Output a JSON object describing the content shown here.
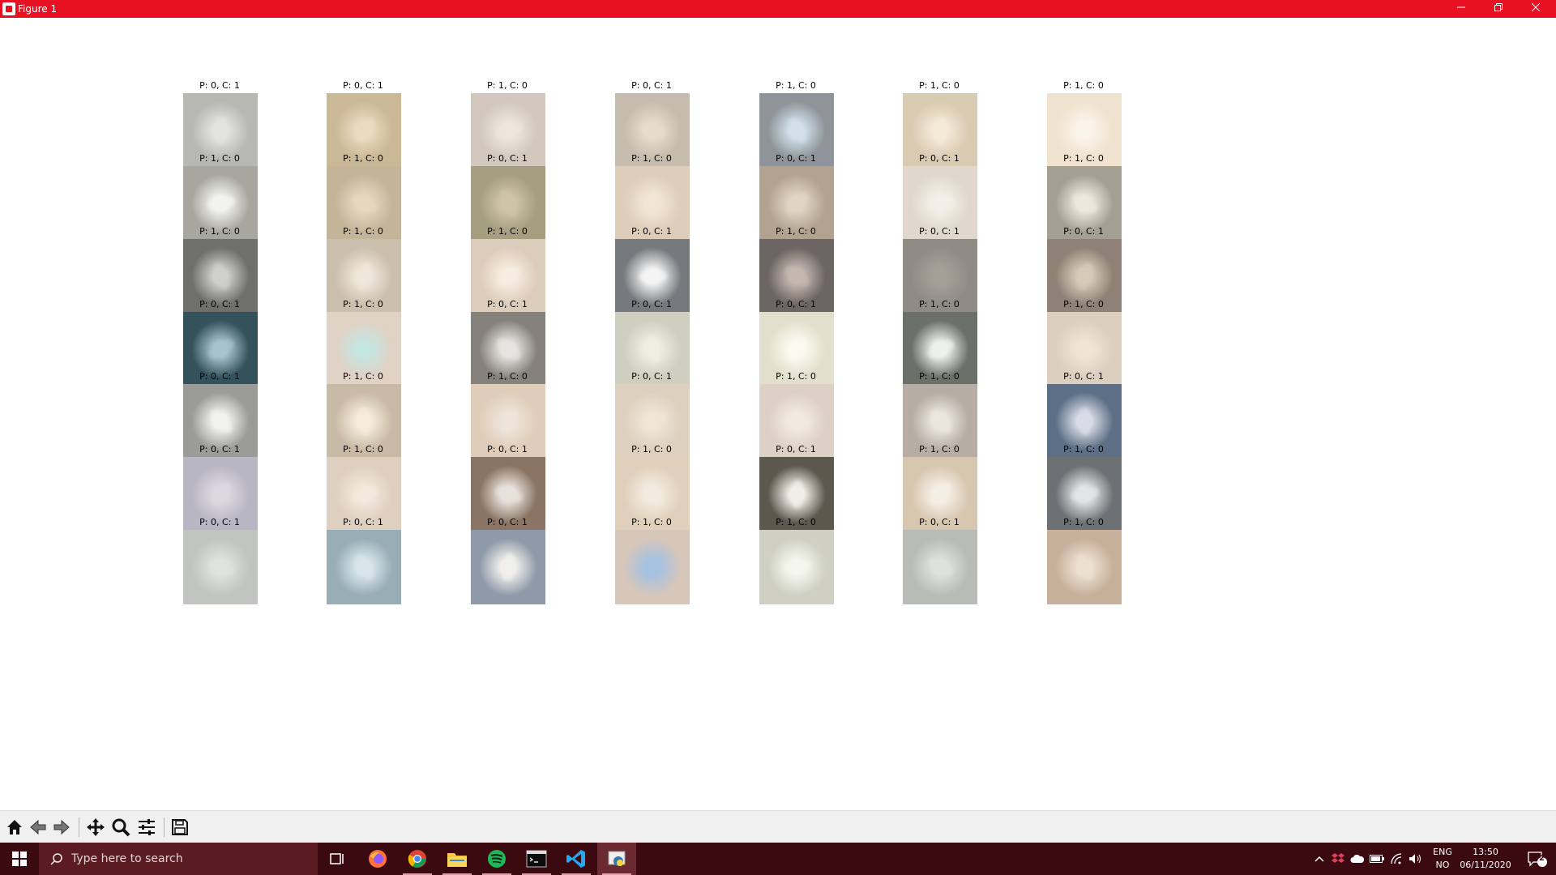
{
  "window": {
    "title": "Figure 1"
  },
  "grid": [
    {
      "label": "P: 0, C: 1",
      "bg": "#b8b8b2",
      "fg": "#e4e4de"
    },
    {
      "label": "P: 0, C: 1",
      "bg": "#cbb896",
      "fg": "#e9dcc0"
    },
    {
      "label": "P: 1, C: 0",
      "bg": "#d2c8bd",
      "fg": "#eee6dc"
    },
    {
      "label": "P: 0, C: 1",
      "bg": "#c6bcae",
      "fg": "#e6dccf"
    },
    {
      "label": "P: 1, C: 0",
      "bg": "#8e9499",
      "fg": "#d2e0ea"
    },
    {
      "label": "P: 1, C: 0",
      "bg": "#d9cab2",
      "fg": "#f4ead8"
    },
    {
      "label": "P: 1, C: 0",
      "bg": "#efe2cf",
      "fg": "#fbf4ea"
    },
    {
      "label": "P: 1, C: 0",
      "bg": "#a8a79f",
      "fg": "#f2f2ee"
    },
    {
      "label": "P: 1, C: 0",
      "bg": "#c4b49a",
      "fg": "#e6d8c0"
    },
    {
      "label": "P: 0, C: 1",
      "bg": "#a59e80",
      "fg": "#cfc4a6"
    },
    {
      "label": "P: 1, C: 0",
      "bg": "#ddcdb9",
      "fg": "#f1e6d6"
    },
    {
      "label": "P: 0, C: 1",
      "bg": "#b2a391",
      "fg": "#e0d4c4"
    },
    {
      "label": "P: 0, C: 1",
      "bg": "#e0d8cc",
      "fg": "#f4efe8"
    },
    {
      "label": "P: 1, C: 0",
      "bg": "#a4a091",
      "fg": "#ece8dd"
    },
    {
      "label": "P: 1, C: 0",
      "bg": "#6f706c",
      "fg": "#cfcfcb"
    },
    {
      "label": "P: 1, C: 0",
      "bg": "#cbbfae",
      "fg": "#efe7da"
    },
    {
      "label": "P: 1, C: 0",
      "bg": "#dcccbb",
      "fg": "#f6ece0"
    },
    {
      "label": "P: 0, C: 1",
      "bg": "#777a7d",
      "fg": "#f4f4f4"
    },
    {
      "label": "P: 1, C: 0",
      "bg": "#6d6563",
      "fg": "#c4b8b0"
    },
    {
      "label": "P: 0, C: 1",
      "bg": "#8f8c86",
      "fg": "#a4a098"
    },
    {
      "label": "P: 0, C: 1",
      "bg": "#8d8275",
      "fg": "#d6cab8"
    },
    {
      "label": "P: 0, C: 1",
      "bg": "#34525c",
      "fg": "#a7c4cb"
    },
    {
      "label": "P: 1, C: 0",
      "bg": "#e0d2c4",
      "fg": "#c6e4e0"
    },
    {
      "label": "P: 0, C: 1",
      "bg": "#85827c",
      "fg": "#e6e4de"
    },
    {
      "label": "P: 0, C: 1",
      "bg": "#cfcfbf",
      "fg": "#eeeee2"
    },
    {
      "label": "P: 0, C: 1",
      "bg": "#e2e0cc",
      "fg": "#fbfaf0"
    },
    {
      "label": "P: 1, C: 0",
      "bg": "#6c706a",
      "fg": "#eef0ea"
    },
    {
      "label": "P: 1, C: 0",
      "bg": "#dccfbf",
      "fg": "#efe4d6"
    },
    {
      "label": "P: 0, C: 1",
      "bg": "#9b9c97",
      "fg": "#f2f2ee"
    },
    {
      "label": "P: 1, C: 0",
      "bg": "#c9baa5",
      "fg": "#f5ecde"
    },
    {
      "label": "P: 1, C: 0",
      "bg": "#e0cdb9",
      "fg": "#eee4da"
    },
    {
      "label": "P: 0, C: 1",
      "bg": "#ddd0bf",
      "fg": "#efe6d8"
    },
    {
      "label": "P: 1, C: 0",
      "bg": "#ddd0c4",
      "fg": "#f2eae0"
    },
    {
      "label": "P: 1, C: 0",
      "bg": "#b6ada4",
      "fg": "#ece6de"
    },
    {
      "label": "P: 0, C: 1",
      "bg": "#5d6f86",
      "fg": "#d8dce6"
    },
    {
      "label": "P: 0, C: 1",
      "bg": "#b9b6c3",
      "fg": "#dcd8e2"
    },
    {
      "label": "P: 1, C: 0",
      "bg": "#decfc0",
      "fg": "#f2e8dc"
    },
    {
      "label": "P: 0, C: 1",
      "bg": "#8a7463",
      "fg": "#e8e2dc"
    },
    {
      "label": "P: 1, C: 0",
      "bg": "#e0d0bb",
      "fg": "#f3ebdf"
    },
    {
      "label": "P: 0, C: 1",
      "bg": "#5d584e",
      "fg": "#f0eee8"
    },
    {
      "label": "P: 1, C: 0",
      "bg": "#d8c7b0",
      "fg": "#f5efe6"
    },
    {
      "label": "P: 1, C: 0",
      "bg": "#6e7173",
      "fg": "#e2e4e6"
    },
    {
      "label": "P: 0, C: 1",
      "bg": "#c2c4c2",
      "fg": "#e0e2e0"
    },
    {
      "label": "P: 0, C: 1",
      "bg": "#98adb6",
      "fg": "#d8e6ec"
    },
    {
      "label": "P: 0, C: 1",
      "bg": "#8e9aa9",
      "fg": "#f1f0ec"
    },
    {
      "label": "P: 1, C: 0",
      "bg": "#d7c6ba",
      "fg": "#a6c2e2"
    },
    {
      "label": "P: 1, C: 0",
      "bg": "#cfd0c3",
      "fg": "#f5f6ee"
    },
    {
      "label": "P: 0, C: 1",
      "bg": "#b9bcb6",
      "fg": "#dfe2da"
    },
    {
      "label": "P: 1, C: 0",
      "bg": "#c7b09b",
      "fg": "#ece0d2"
    }
  ],
  "toolbar": {
    "buttons": [
      {
        "name": "home-button",
        "icon": "home-icon"
      },
      {
        "name": "back-button",
        "icon": "arrow-left-icon"
      },
      {
        "name": "forward-button",
        "icon": "arrow-right-icon"
      },
      {
        "name": "pan-button",
        "icon": "move-icon"
      },
      {
        "name": "zoom-button",
        "icon": "magnifier-icon"
      },
      {
        "name": "configure-subplots-button",
        "icon": "sliders-icon"
      },
      {
        "name": "save-button",
        "icon": "floppy-disk-icon"
      }
    ]
  },
  "taskbar": {
    "search_placeholder": "Type here to search",
    "lang_1": "ENG",
    "lang_2": "NO",
    "time": "13:50",
    "date": "06/11/2020",
    "notification_count": "2"
  }
}
